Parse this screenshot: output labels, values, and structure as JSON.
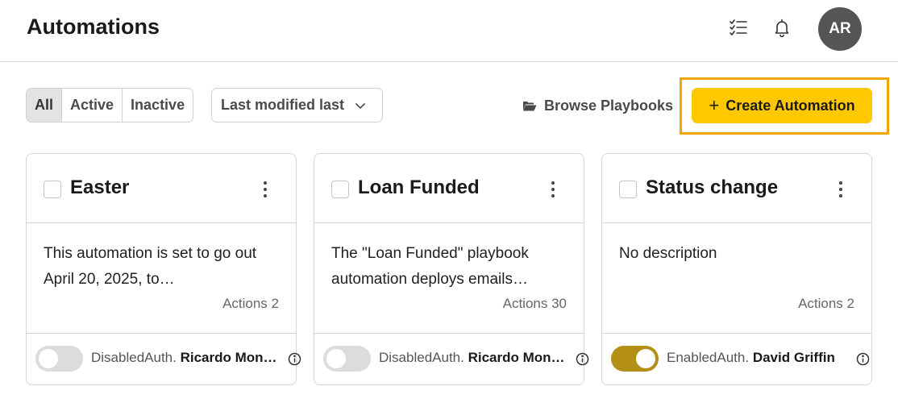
{
  "header": {
    "title": "Automations",
    "avatar_initials": "AR",
    "icons": [
      "checklist-icon",
      "bell-icon"
    ]
  },
  "filters": {
    "segments": [
      {
        "label": "All",
        "active": true
      },
      {
        "label": "Active",
        "active": false
      },
      {
        "label": "Inactive",
        "active": false
      }
    ],
    "sort_label": "Last modified last"
  },
  "toolbar": {
    "browse_label": "Browse Playbooks",
    "create_label": "Create Automation"
  },
  "colors": {
    "accent": "#ffc800",
    "highlight_border": "#f2a500",
    "toggle_on": "#b38f16"
  },
  "cards": [
    {
      "title": "Easter",
      "description": "This automation is set to go out April 20, 2025, to…",
      "actions": "Actions 2",
      "status": "Disabled",
      "enabled": false,
      "auth_prefix": "Auth.",
      "author": "Ricardo Mon…"
    },
    {
      "title": "Loan Funded",
      "description": "The \"Loan Funded\" playbook automation deploys emails…",
      "actions": "Actions 30",
      "status": "Disabled",
      "enabled": false,
      "auth_prefix": "Auth.",
      "author": "Ricardo Mon…"
    },
    {
      "title": "Status change",
      "description": "No description",
      "actions": "Actions 2",
      "status": "Enabled",
      "enabled": true,
      "auth_prefix": "Auth.",
      "author": "David Griffin"
    }
  ]
}
